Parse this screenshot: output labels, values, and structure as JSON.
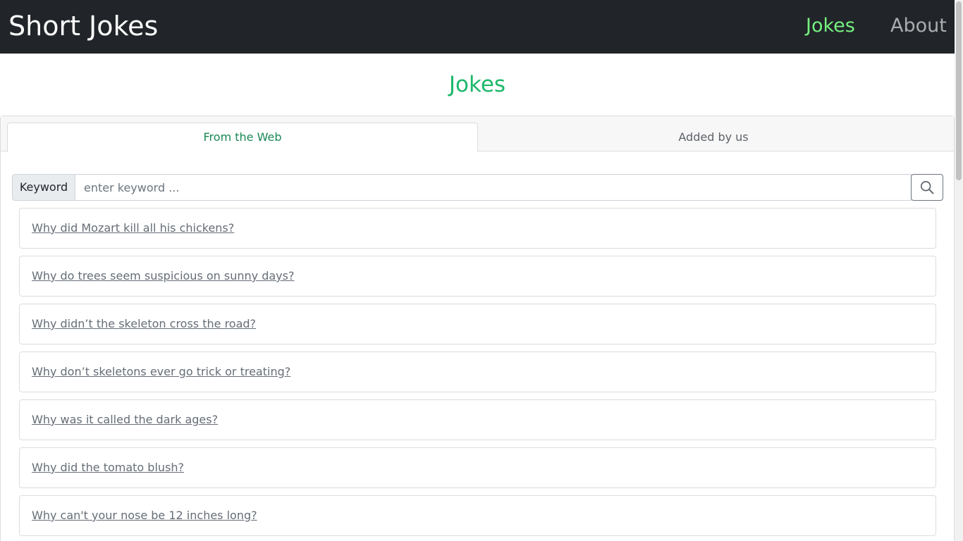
{
  "navbar": {
    "brand": "Short Jokes",
    "links": [
      {
        "label": "Jokes",
        "active": true
      },
      {
        "label": "About",
        "active": false
      }
    ]
  },
  "page_title": "Jokes",
  "tabs": [
    {
      "label": "From the Web",
      "active": true
    },
    {
      "label": "Added by us",
      "active": false
    }
  ],
  "search": {
    "label": "Keyword",
    "placeholder": "enter keyword ...",
    "value": "",
    "button_icon": "search-icon"
  },
  "jokes": [
    "Why did Mozart kill all his chickens?",
    "Why do trees seem suspicious on sunny days?",
    "Why didn’t the skeleton cross the road?",
    "Why don’t skeletons ever go trick or treating?",
    "Why was it called the dark ages?",
    "Why did the tomato blush?",
    "Why can't your nose be 12 inches long?"
  ],
  "colors": {
    "navbar_bg": "#212529",
    "accent": "#1cb86a",
    "nav_active": "#75f07f",
    "link_text": "#666d76"
  }
}
